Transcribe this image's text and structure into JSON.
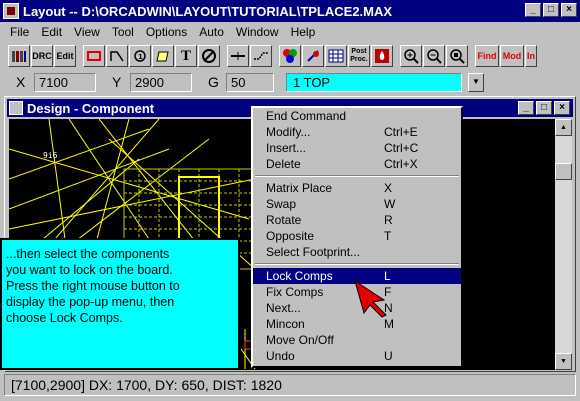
{
  "window": {
    "title": "Layout -- D:\\ORCADWIN\\LAYOUT\\TUTORIAL\\TPLACE2.MAX",
    "buttons": [
      "_",
      "□",
      "×"
    ]
  },
  "menu": [
    "File",
    "Edit",
    "View",
    "Tool",
    "Options",
    "Auto",
    "Window",
    "Help"
  ],
  "toolbar": {
    "drc_label": "DRC",
    "edit_label": "Edit",
    "text_label": "T",
    "post_label": "Post Proc.",
    "find_label": "Find",
    "mod_label": "Mod",
    "ins_label": "In"
  },
  "coords": {
    "x_label": "X",
    "x_value": "7100",
    "y_label": "Y",
    "y_value": "2900",
    "g_label": "G",
    "g_value": "50",
    "layer_value": "1 TOP"
  },
  "child_window": {
    "title": "Design - Component"
  },
  "canvas_labels": {
    "pin_label": "9i6"
  },
  "callout": {
    "text": "...then select the components\nyou want to lock on the board.\nPress the right mouse button to\ndisplay the pop-up menu, then\nchoose Lock Comps."
  },
  "popup_menu": {
    "groups": [
      [
        {
          "label": "End Command",
          "shortcut": ""
        },
        {
          "label": "Modify...",
          "shortcut": "Ctrl+E"
        },
        {
          "label": "Insert...",
          "shortcut": "Ctrl+C"
        },
        {
          "label": "Delete",
          "shortcut": "Ctrl+X"
        }
      ],
      [
        {
          "label": "Matrix Place",
          "shortcut": "X"
        },
        {
          "label": "Swap",
          "shortcut": "W"
        },
        {
          "label": "Rotate",
          "shortcut": "R"
        },
        {
          "label": "Opposite",
          "shortcut": "T"
        },
        {
          "label": "Select Footprint...",
          "shortcut": ""
        }
      ],
      [
        {
          "label": "Lock Comps",
          "shortcut": "L",
          "selected": true
        },
        {
          "label": "Fix Comps",
          "shortcut": "F"
        },
        {
          "label": "Next...",
          "shortcut": "N"
        },
        {
          "label": "Mincon",
          "shortcut": "M"
        },
        {
          "label": "Move On/Off",
          "shortcut": ""
        },
        {
          "label": "Undo",
          "shortcut": "U"
        }
      ]
    ]
  },
  "status": {
    "text": "[7100,2900] DX: 1700, DY: 650, DIST: 1820"
  },
  "colors": {
    "title_bar": "#000080",
    "layer_field": "#00ffff",
    "callout": "#00ffff",
    "traces": "#ffff00",
    "cursor": "#e00000"
  }
}
